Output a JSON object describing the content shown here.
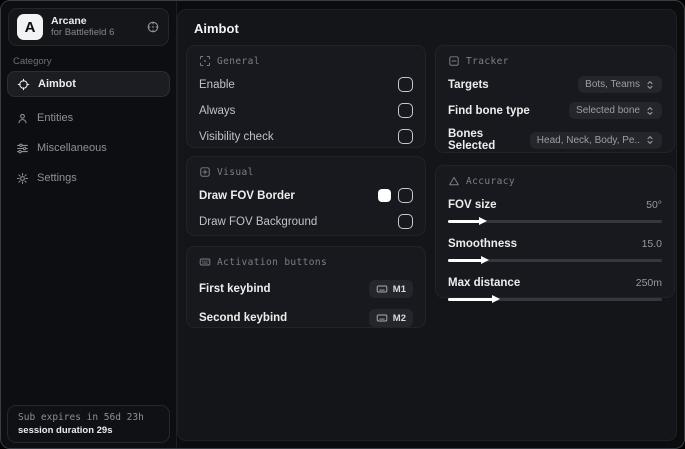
{
  "sidebar": {
    "logo": {
      "initial": "A",
      "title": "Arcane",
      "subtitle": "for Battlefield 6"
    },
    "category_label": "Category",
    "items": [
      {
        "label": "Aimbot",
        "icon": "crosshair-icon",
        "active": true
      },
      {
        "label": "Entities",
        "icon": "person-icon",
        "active": false
      },
      {
        "label": "Miscellaneous",
        "icon": "sliders-icon",
        "active": false
      },
      {
        "label": "Settings",
        "icon": "gear-icon",
        "active": false
      }
    ],
    "footer": {
      "expiry": "Sub expires in 56d 23h",
      "session": "session duration 29s"
    }
  },
  "main": {
    "title": "Aimbot",
    "general": {
      "title": "General",
      "icon": "scan-icon",
      "rows": [
        {
          "label": "Enable",
          "control": "checkbox",
          "checked": false
        },
        {
          "label": "Always",
          "control": "checkbox",
          "checked": false
        },
        {
          "label": "Visibility check",
          "control": "checkbox",
          "checked": false
        }
      ]
    },
    "visual": {
      "title": "Visual",
      "icon": "frame-plus-icon",
      "rows": [
        {
          "label": "Draw FOV Border",
          "control": "checkbox",
          "checked": false,
          "swatch_color": "#ffffff"
        },
        {
          "label": "Draw FOV Background",
          "control": "checkbox",
          "checked": false
        }
      ]
    },
    "activation": {
      "title": "Activation buttons",
      "icon": "keyboard-icon",
      "rows": [
        {
          "label": "First keybind",
          "key": "M1"
        },
        {
          "label": "Second keybind",
          "key": "M2"
        }
      ]
    },
    "tracker": {
      "title": "Tracker",
      "icon": "square-minus-icon",
      "rows": [
        {
          "label": "Targets",
          "value": "Bots, Teams"
        },
        {
          "label": "Find bone type",
          "value": "Selected bone"
        },
        {
          "label": "Bones Selected",
          "value": "Head, Neck, Body, Pe.."
        }
      ]
    },
    "accuracy": {
      "title": "Accuracy",
      "icon": "triangle-icon",
      "rows": [
        {
          "label": "FOV size",
          "value": "50°",
          "percent": 15
        },
        {
          "label": "Smoothness",
          "value": "15.0",
          "percent": 16
        },
        {
          "label": "Max distance",
          "value": "250m",
          "percent": 21
        }
      ]
    }
  },
  "colors": {
    "page_bg": "#0b0c0e",
    "panel_bg": "#141519",
    "card_bg": "#18191e",
    "accent": "#ffffff",
    "text_primary": "#eceded",
    "text_secondary": "#9a9ea5"
  }
}
